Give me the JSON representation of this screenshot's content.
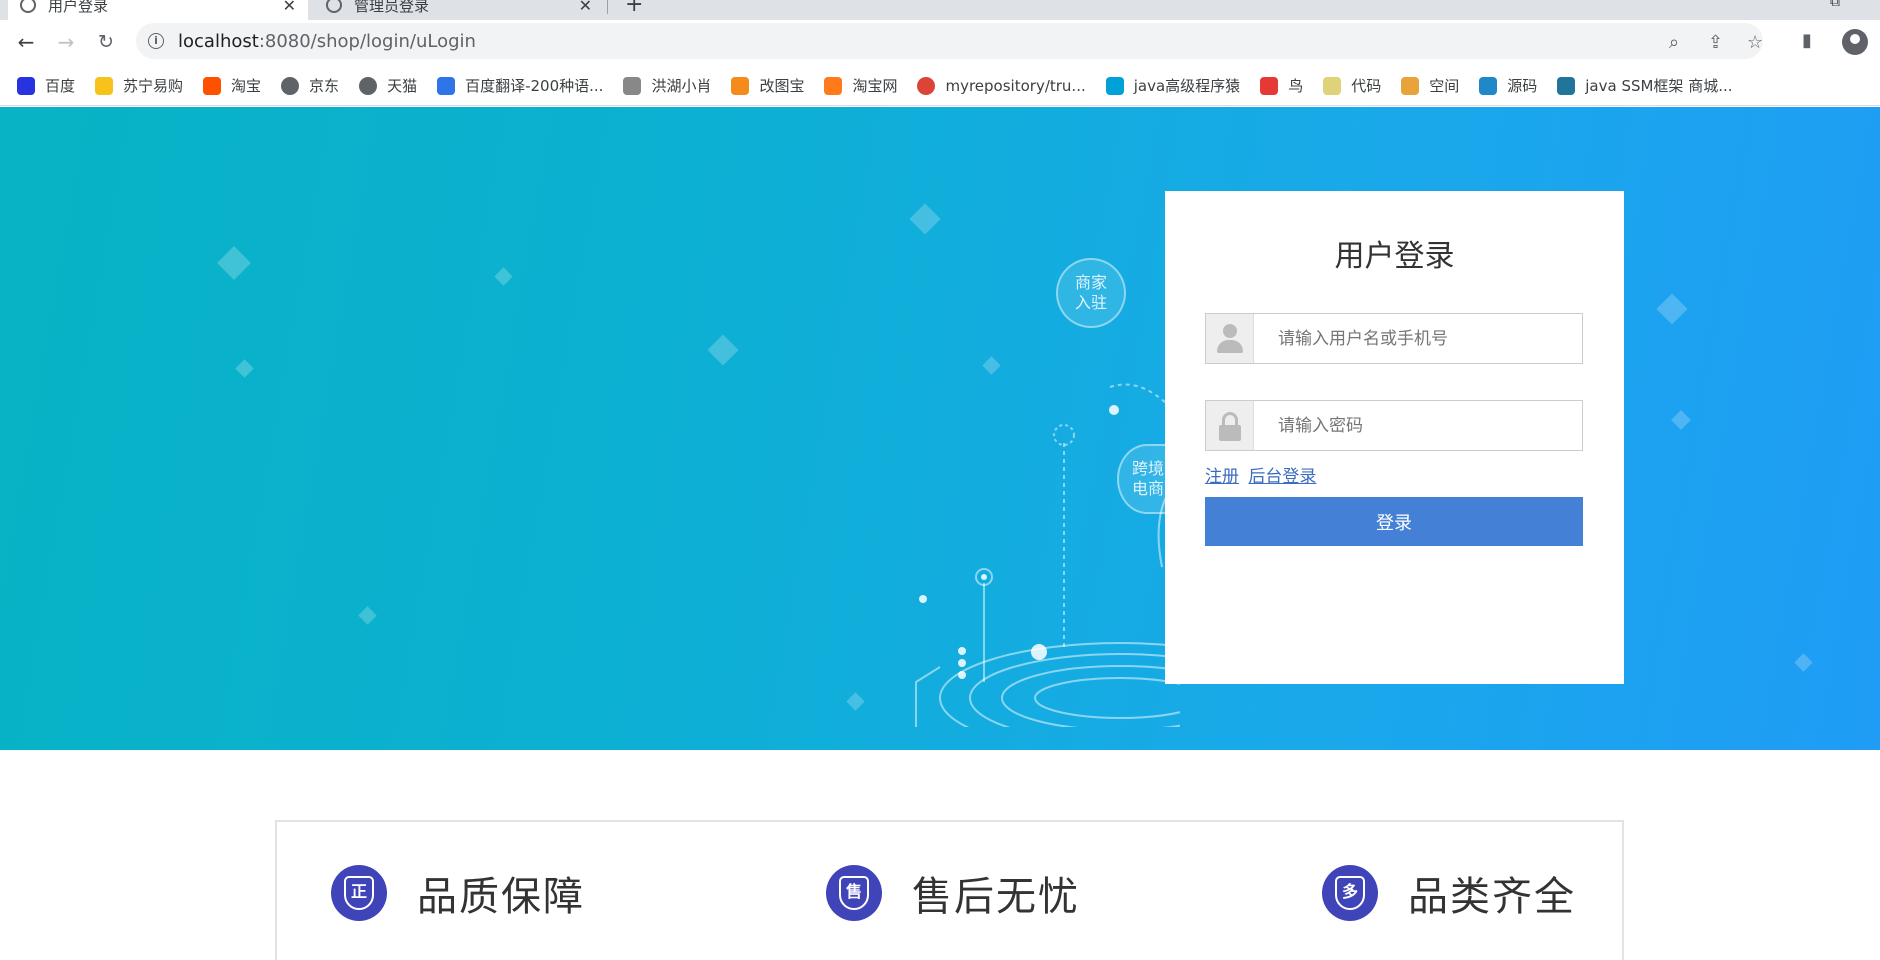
{
  "browser": {
    "tabs": [
      {
        "title": "用户登录",
        "active": true
      },
      {
        "title": "管理员登录",
        "active": false
      }
    ],
    "url_host": "localhost",
    "url_path": ":8080/shop/login/uLogin",
    "bookmarks": [
      {
        "label": "百度",
        "icon": "baidu-paw-icon",
        "color": "#2932e1"
      },
      {
        "label": "苏宁易购",
        "icon": "suning-lion-icon",
        "color": "#f7c21b"
      },
      {
        "label": "淘宝",
        "icon": "taobao-icon",
        "color": "#ff5000"
      },
      {
        "label": "京东",
        "icon": "globe-icon",
        "color": "#5f6368"
      },
      {
        "label": "天猫",
        "icon": "globe-icon",
        "color": "#5f6368"
      },
      {
        "label": "百度翻译-200种语...",
        "icon": "translate-icon",
        "color": "#2f75e8"
      },
      {
        "label": "洪湖小肖",
        "icon": "hhxx-icon",
        "color": "#888888"
      },
      {
        "label": "改图宝",
        "icon": "gaitubao-icon",
        "color": "#f48b1c"
      },
      {
        "label": "淘宝网",
        "icon": "taobao-icon",
        "color": "#ff7a1a"
      },
      {
        "label": "myrepository/tru...",
        "icon": "chrome-icon",
        "color": "#db4437"
      },
      {
        "label": "java高级程序猿",
        "icon": "bilibili-icon",
        "color": "#00a1d6"
      },
      {
        "label": "鸟",
        "icon": "bird-icon",
        "color": "#e53935"
      },
      {
        "label": "代码",
        "icon": "code-icon",
        "color": "#e0d27a"
      },
      {
        "label": "空间",
        "icon": "qzone-icon",
        "color": "#e8a33a"
      },
      {
        "label": "源码",
        "icon": "fish-icon",
        "color": "#1e88c9"
      },
      {
        "label": "java SSM框架 商城...",
        "icon": "wordpress-icon",
        "color": "#21759b"
      }
    ]
  },
  "login": {
    "title": "用户登录",
    "username_placeholder": "请输入用户名或手机号",
    "password_placeholder": "请输入密码",
    "register_link": "注册",
    "admin_link": "后台登录",
    "submit_label": "登录"
  },
  "decoration": {
    "bubble1": "商家\n入驻",
    "bubble2": "跨境\n电商"
  },
  "features": [
    {
      "badge": "正",
      "label": "品质保障"
    },
    {
      "badge": "售",
      "label": "售后无忧"
    },
    {
      "badge": "多",
      "label": "品类齐全"
    }
  ],
  "colors": {
    "banner_start": "#07b3c4",
    "banner_end": "#1f9cf5",
    "button": "#4481d6",
    "badge": "#3f45b8",
    "link": "#3b6cc0"
  }
}
